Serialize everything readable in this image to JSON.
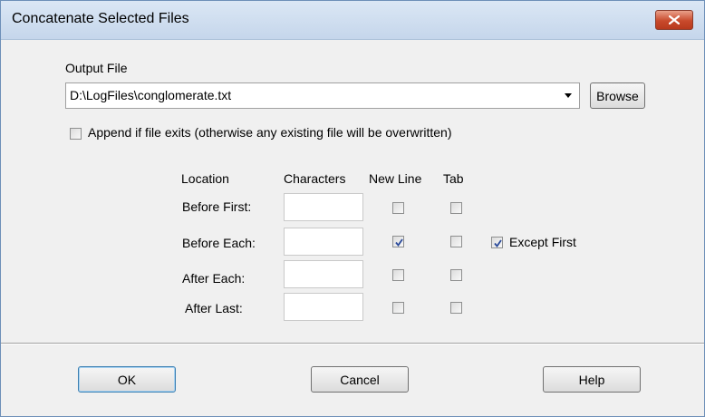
{
  "window": {
    "title": "Concatenate Selected Files"
  },
  "output": {
    "label": "Output File",
    "value": "D:\\LogFiles\\conglomerate.txt",
    "browse_label": "Browse"
  },
  "append": {
    "label": "Append if file exits (otherwise any existing file will be overwritten)",
    "checked": false
  },
  "grid": {
    "headers": {
      "location": "Location",
      "characters": "Characters",
      "newline": "New Line",
      "tab": "Tab"
    },
    "rows": [
      {
        "label": "Before First:",
        "characters": "",
        "newline": false,
        "tab": false
      },
      {
        "label": "Before Each:",
        "characters": "",
        "newline": true,
        "tab": false,
        "extra_label": "Except First",
        "extra_checked": true
      },
      {
        "label": "After Each:",
        "characters": "",
        "newline": false,
        "tab": false
      },
      {
        "label": "After Last:",
        "characters": "",
        "newline": false,
        "tab": false
      }
    ]
  },
  "buttons": {
    "ok": "OK",
    "cancel": "Cancel",
    "help": "Help"
  }
}
